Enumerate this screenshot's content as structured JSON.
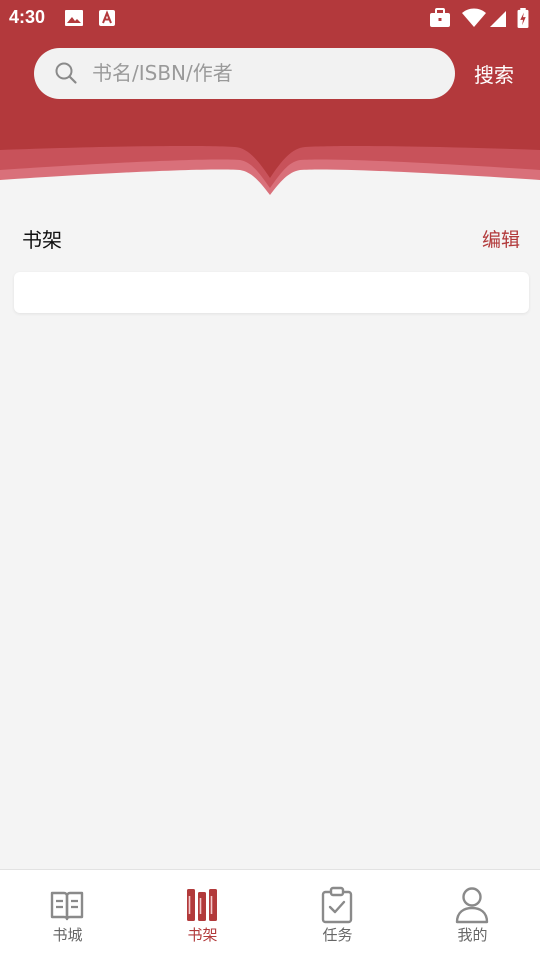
{
  "status_bar": {
    "time": "4:30",
    "icons": [
      "image-icon",
      "a-font-icon",
      "briefcase-icon",
      "wifi-icon",
      "signal-icon",
      "battery-charging-icon"
    ]
  },
  "search": {
    "placeholder": "书名/ISBN/作者",
    "button_label": "搜索"
  },
  "shelf": {
    "title": "书架",
    "edit_label": "编辑"
  },
  "tabs": [
    {
      "label": "书城",
      "icon": "open-book-icon",
      "active": false
    },
    {
      "label": "书架",
      "icon": "bookshelf-icon",
      "active": true
    },
    {
      "label": "任务",
      "icon": "clipboard-check-icon",
      "active": false
    },
    {
      "label": "我的",
      "icon": "user-icon",
      "active": false
    }
  ],
  "colors": {
    "brand": "#b23a3b",
    "brand_light": "#d9666d",
    "background": "#f4f4f4",
    "tab_inactive": "#666666"
  }
}
